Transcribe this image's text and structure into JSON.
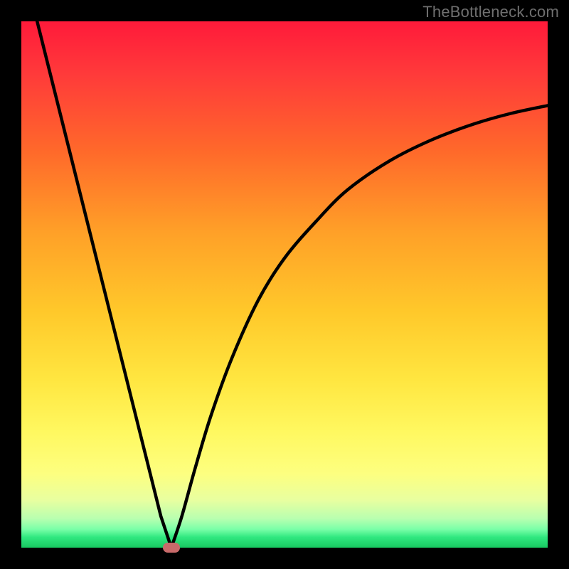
{
  "watermark": {
    "text": "TheBottleneck.com"
  },
  "colors": {
    "gradient_top": "#ff1a3a",
    "gradient_mid": "#ffd040",
    "gradient_bottom": "#18c860",
    "curve": "#000000",
    "frame": "#000000",
    "marker": "#c86a6a"
  },
  "chart_data": {
    "type": "line",
    "title": "",
    "xlabel": "",
    "ylabel": "",
    "xlim": [
      0,
      100
    ],
    "ylim": [
      0,
      100
    ],
    "grid": false,
    "legend": false,
    "annotations": [
      {
        "kind": "marker",
        "x": 28.5,
        "y": 0,
        "shape": "pill",
        "color": "#c86a6a"
      }
    ],
    "series": [
      {
        "name": "left-branch",
        "x": [
          3,
          6,
          9,
          12,
          15,
          18,
          21,
          24,
          26.5,
          28.5
        ],
        "y": [
          100,
          88,
          76,
          64,
          52,
          40,
          28,
          16,
          6,
          0
        ]
      },
      {
        "name": "right-branch",
        "x": [
          28.5,
          30.5,
          33,
          36,
          40,
          45,
          50,
          56,
          62,
          70,
          78,
          86,
          93,
          100
        ],
        "y": [
          0,
          6,
          15,
          25,
          36,
          47,
          55,
          62,
          68,
          73.5,
          77.5,
          80.5,
          82.5,
          84
        ]
      }
    ]
  }
}
